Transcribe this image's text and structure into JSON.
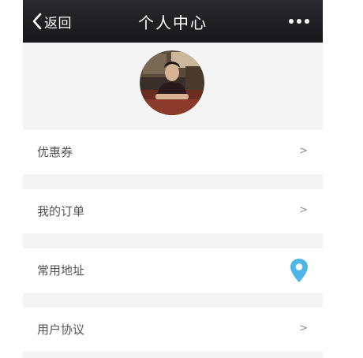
{
  "header": {
    "back_label": "返回",
    "title": "个人中心",
    "more_icon": "more-dots-icon"
  },
  "menu": {
    "items": [
      {
        "label": "优惠券",
        "indicator": ">"
      },
      {
        "label": "我的订单",
        "indicator": ">"
      },
      {
        "label": "常用地址",
        "icon": "location-pin-icon"
      },
      {
        "label": "用户协议",
        "indicator": ">"
      }
    ]
  },
  "colors": {
    "navbar": "#1f1f23",
    "background": "#f4f4f4",
    "pin": "#4fb7e8"
  }
}
